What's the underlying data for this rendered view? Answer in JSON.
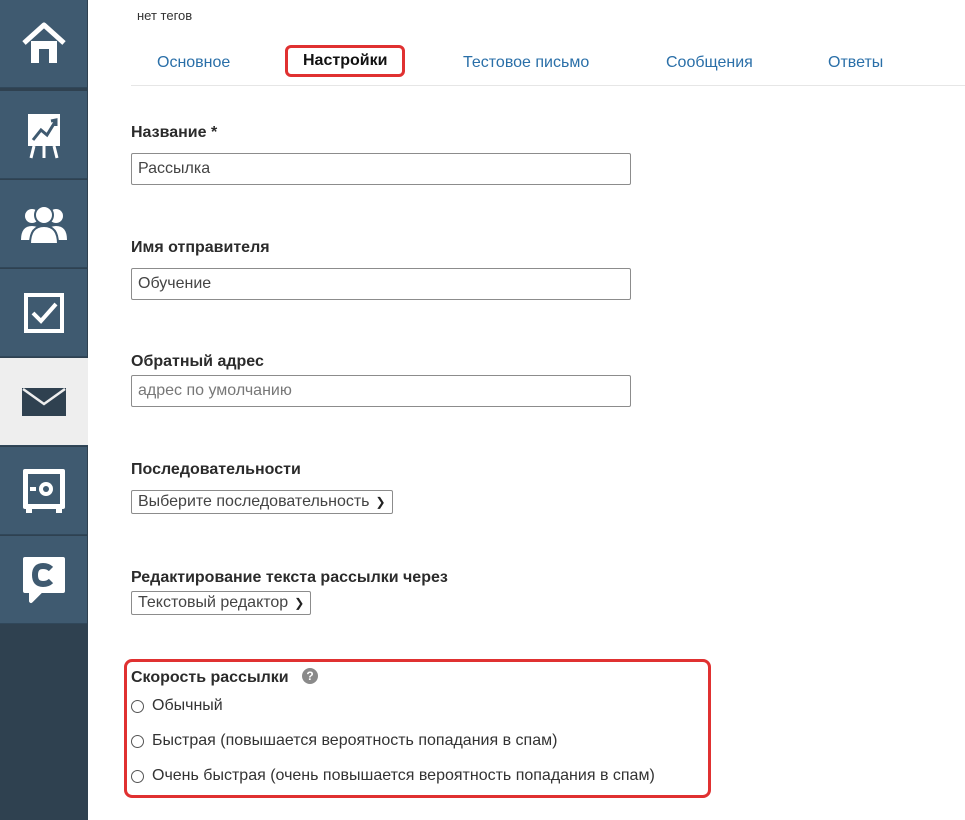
{
  "sidebar": {
    "items": [
      {
        "icon": "home-icon",
        "active": false
      },
      {
        "icon": "chart-icon",
        "active": false
      },
      {
        "icon": "users-icon",
        "active": false
      },
      {
        "icon": "tasks-icon",
        "active": false
      },
      {
        "icon": "mail-icon",
        "active": true
      },
      {
        "icon": "safe-icon",
        "active": false
      },
      {
        "icon": "chat-icon",
        "active": false
      }
    ]
  },
  "header": {
    "tags_text": "нет тегов"
  },
  "tabs": [
    {
      "label": "Основное"
    },
    {
      "label": "Настройки",
      "active": true
    },
    {
      "label": "Тестовое письмо"
    },
    {
      "label": "Сообщения"
    },
    {
      "label": "Ответы"
    }
  ],
  "form": {
    "name": {
      "label": "Название *",
      "value": "Рассылка"
    },
    "sender": {
      "label": "Имя отправителя",
      "value": "Обучение"
    },
    "reply_to": {
      "label": "Обратный адрес",
      "placeholder": "адрес по умолчанию"
    },
    "sequences": {
      "label": "Последовательности",
      "selected": "Выберите последовательность"
    },
    "editor": {
      "label": "Редактирование текста рассылки через",
      "selected": "Текстовый редактор"
    },
    "speed": {
      "label": "Скорость рассылки",
      "help_glyph": "?",
      "options": [
        {
          "label": "Обычный"
        },
        {
          "label": "Быстрая (повышается вероятность попадания в спам)"
        },
        {
          "label": "Очень быстрая (очень повышается вероятность попадания в спам)"
        }
      ]
    }
  },
  "colors": {
    "sidebar_bg": "#2f4150",
    "sidebar_item": "#3f5a70",
    "link": "#2a6fa8",
    "highlight": "#e03131"
  }
}
